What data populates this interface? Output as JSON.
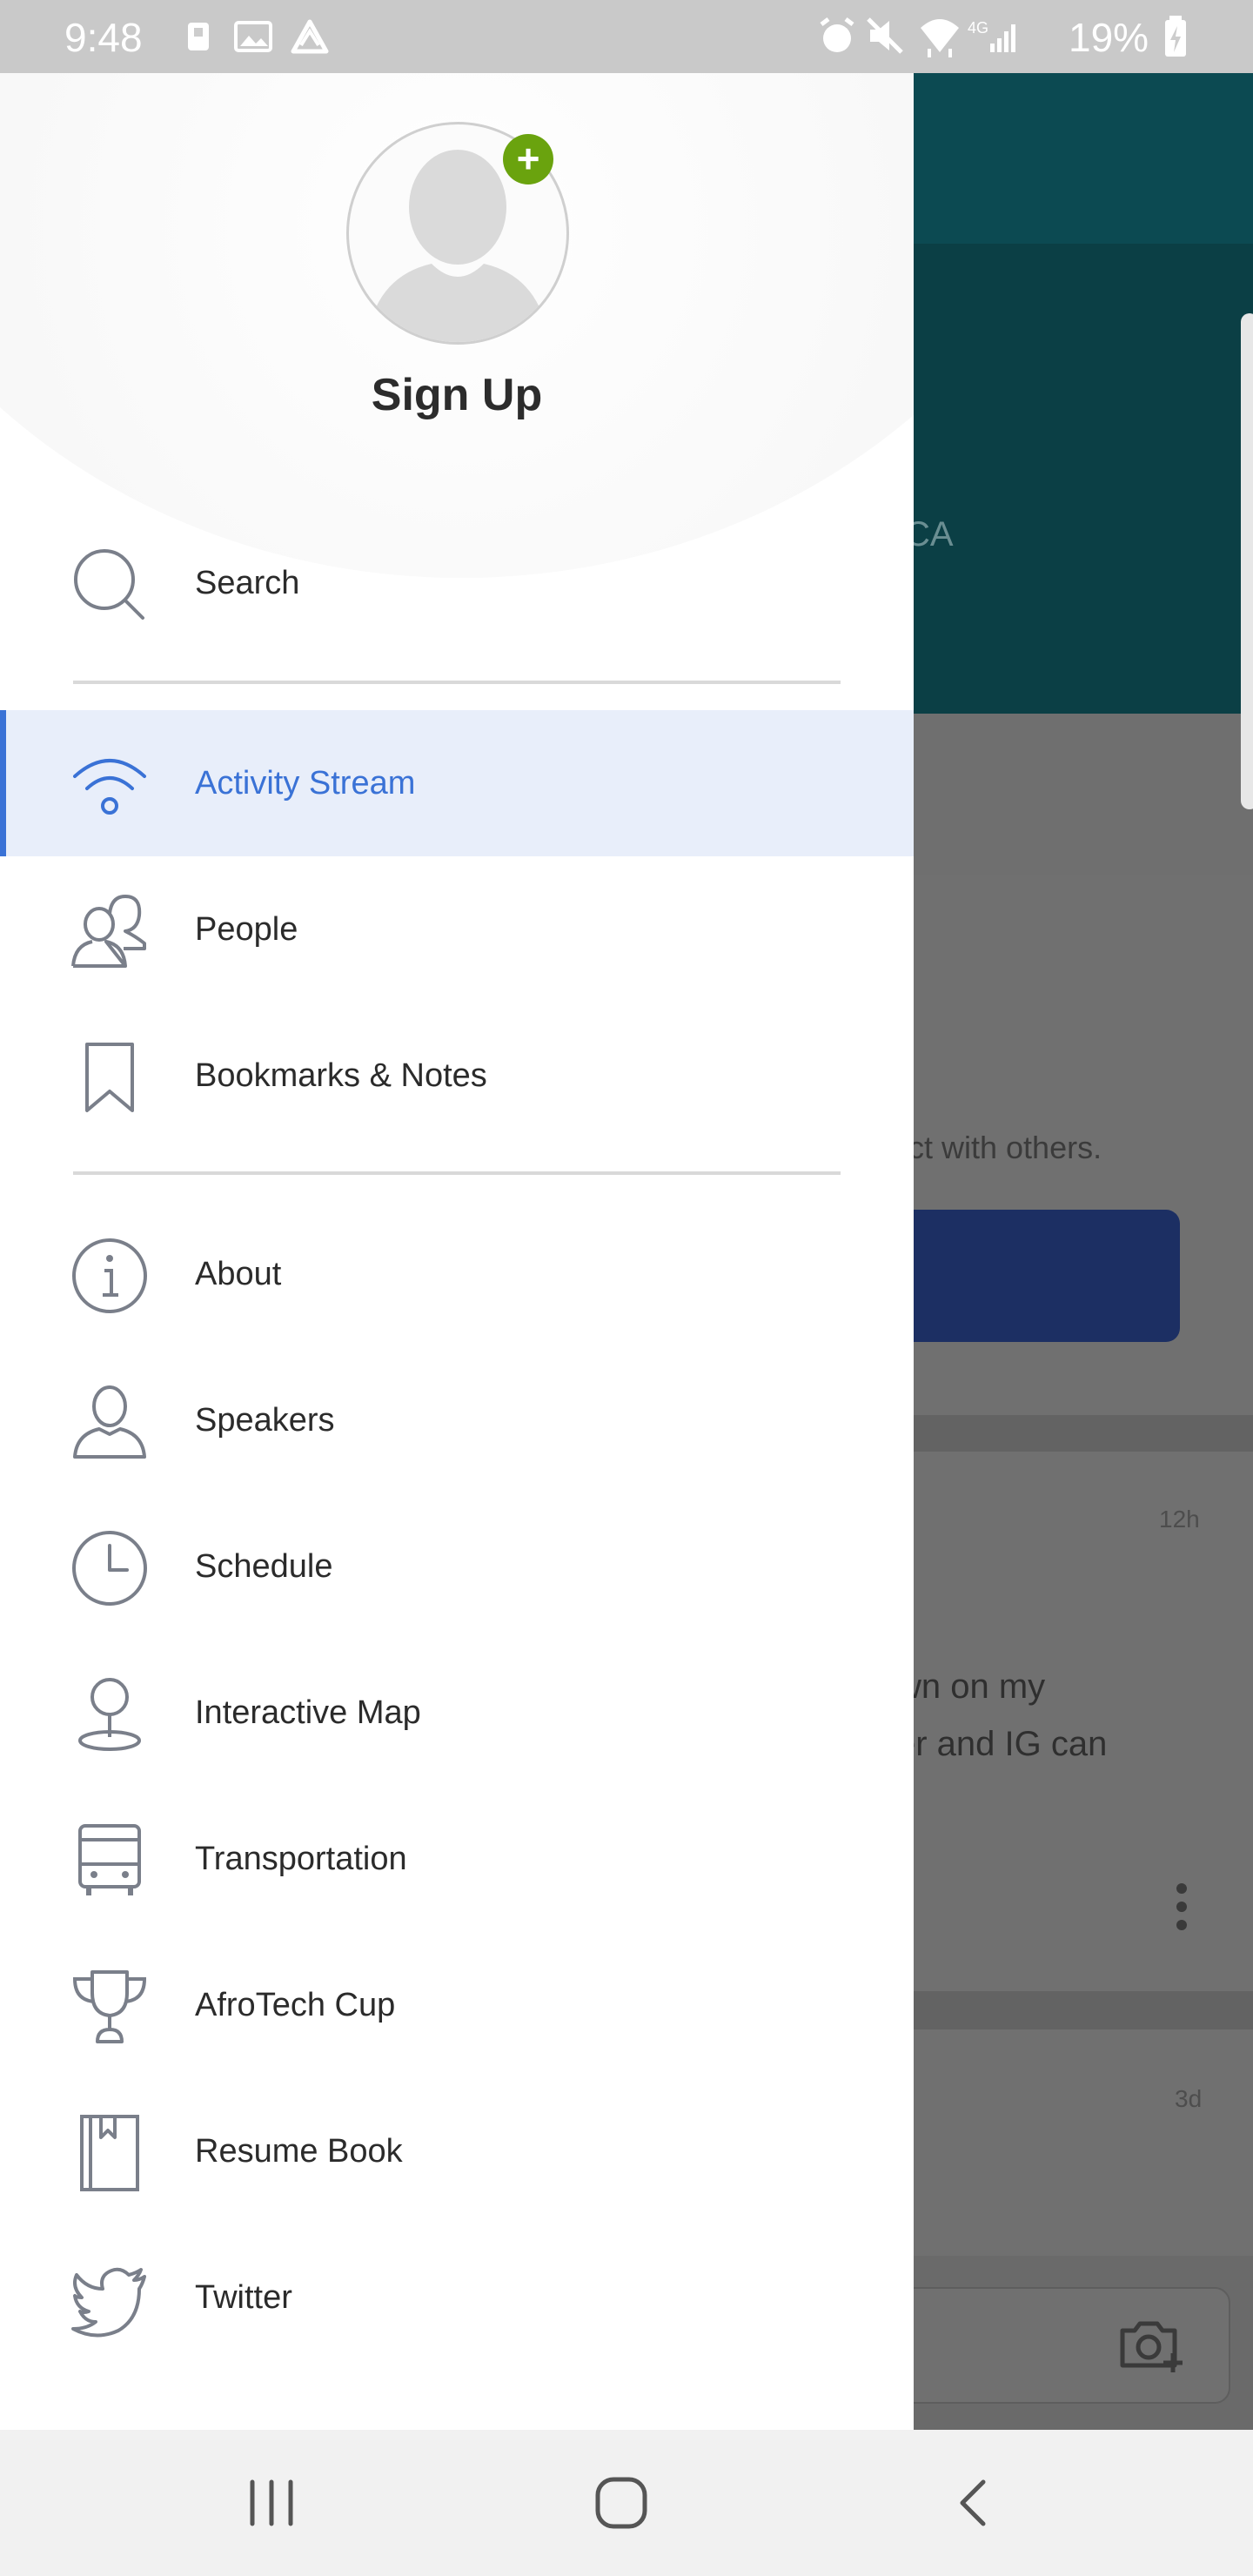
{
  "status_bar": {
    "time": "9:48",
    "battery": "19%"
  },
  "background": {
    "banner_text": "CA",
    "card_text": "ct with others.",
    "post_time_1": "12h",
    "post_line_1": "wn on my",
    "post_line_2": "er and IG can",
    "post_time_2": "3d"
  },
  "drawer": {
    "profile_label": "Sign Up",
    "search_label": "Search",
    "primary_items": [
      {
        "label": "Activity Stream",
        "icon": "wifi-icon",
        "active": true
      },
      {
        "label": "People",
        "icon": "people-icon"
      },
      {
        "label": "Bookmarks & Notes",
        "icon": "bookmark-icon"
      }
    ],
    "secondary_items": [
      {
        "label": "About",
        "icon": "info-icon"
      },
      {
        "label": "Speakers",
        "icon": "person-icon"
      },
      {
        "label": "Schedule",
        "icon": "clock-icon"
      },
      {
        "label": "Interactive Map",
        "icon": "map-pin-icon"
      },
      {
        "label": "Transportation",
        "icon": "bus-icon"
      },
      {
        "label": "AfroTech Cup",
        "icon": "trophy-icon"
      },
      {
        "label": "Resume Book",
        "icon": "book-icon"
      },
      {
        "label": "Twitter",
        "icon": "twitter-icon"
      }
    ]
  },
  "colors": {
    "accent": "#3a72d6",
    "active_bg": "#e8eefa",
    "add_badge": "#6aa30e",
    "icon_gray": "#7a7f8a"
  }
}
